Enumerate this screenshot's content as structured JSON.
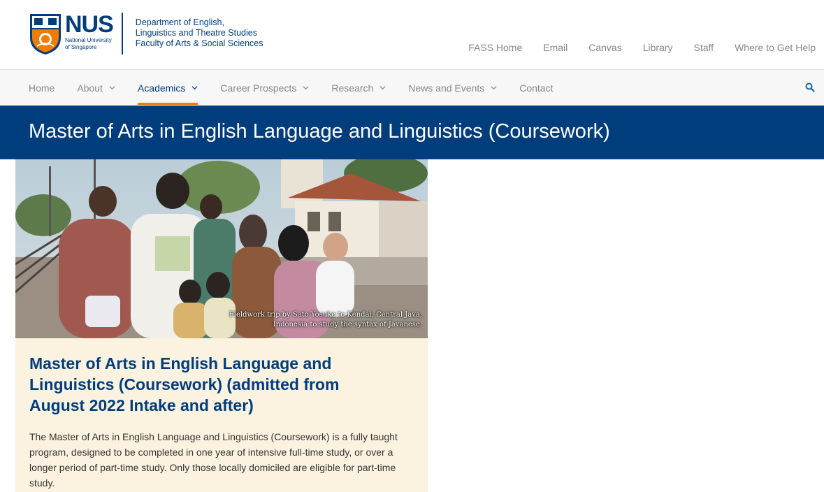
{
  "logo": {
    "wordmark": "NUS",
    "university_line1": "National University",
    "university_line2": "of Singapore"
  },
  "department": {
    "line1": "Department of English,",
    "line2": "Linguistics and Theatre Studies",
    "line3": "Faculty of Arts & Social Sciences"
  },
  "utility_links": [
    "FASS Home",
    "Email",
    "Canvas",
    "Library",
    "Staff",
    "Where to Get Help"
  ],
  "nav": {
    "items": [
      {
        "label": "Home",
        "dropdown": false
      },
      {
        "label": "About",
        "dropdown": true
      },
      {
        "label": "Academics",
        "dropdown": true,
        "active": true
      },
      {
        "label": "Career Prospects",
        "dropdown": true
      },
      {
        "label": "Research",
        "dropdown": true
      },
      {
        "label": "News and Events",
        "dropdown": true
      },
      {
        "label": "Contact",
        "dropdown": false
      }
    ],
    "search_icon": "search-icon",
    "active_color": "#003d7c",
    "underline_color": "#ef7c00"
  },
  "banner": {
    "title": "Master of Arts in English Language and Linguistics (Coursework)",
    "background": "#003d7c"
  },
  "photo": {
    "caption_line1": "Fieldwork trip by Sato Yosuke to Kendal, Central Java,",
    "caption_line2": "Indonesia to study the syntax of Javanese."
  },
  "card": {
    "heading": "Master of Arts in English Language and Linguistics (Coursework) (admitted from August 2022 Intake and after)",
    "body": "The Master of Arts in English Language and Linguistics (Coursework) is a fully taught program, designed to be completed in one year of intensive full-time study, or over a longer period of part-time study. Only those locally domiciled are eligible for part-time study.",
    "background": "#fcf2e0"
  }
}
